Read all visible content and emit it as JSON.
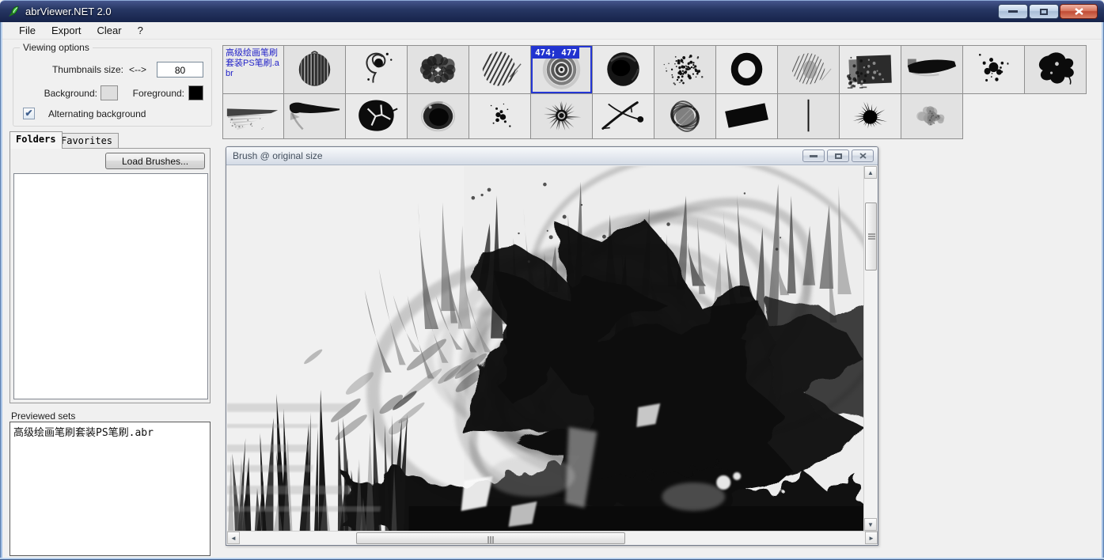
{
  "app": {
    "title": "abrViewer.NET 2.0"
  },
  "menu": {
    "items": [
      {
        "label": "File"
      },
      {
        "label": "Export"
      },
      {
        "label": "Clear"
      },
      {
        "label": "?"
      }
    ]
  },
  "viewing_options": {
    "group_label": "Viewing options",
    "thumbnails_size_label": "Thumbnails size:",
    "size_arrows": "<-->",
    "thumbnails_size_value": "80",
    "background_label": "Background:",
    "background_color": "#dedede",
    "foreground_label": "Foreground:",
    "foreground_color": "#000000",
    "alternating_label": "Alternating background",
    "alternating_checked": true
  },
  "tabs": [
    {
      "label": "Folders",
      "active": true
    },
    {
      "label": "Favorites",
      "active": false
    }
  ],
  "load_brushes_button": "Load Brushes...",
  "folder_list": {
    "items": []
  },
  "previewed_sets": {
    "label": "Previewed sets",
    "items": [
      "高级绘画笔刷套装PS笔刷.abr"
    ]
  },
  "brush_grid": {
    "set_name": "高级绘画笔刷套装PS笔刷.abr",
    "selected": {
      "row": 0,
      "index": 5,
      "size_label": "474; 477"
    },
    "row1": [
      "set-label",
      "streaked-sphere",
      "swirl-dots",
      "fuzzy-rosette",
      "hatch-ball",
      "concentric-rings",
      "glossy-ball",
      "speckle-blob",
      "thick-ring",
      "fingerprint-oval",
      "grunge-block",
      "dark-wedge",
      "splat-dots",
      "ink-splat"
    ],
    "row2": [
      "fade-smear",
      "taper-stroke",
      "cracked-rock",
      "dark-iris",
      "dot-cluster",
      "starburst",
      "twigs",
      "scribble-ball",
      "black-rect",
      "vertical-line",
      "spiky-tuft",
      "mottled-blob"
    ]
  },
  "preview_window": {
    "title": "Brush @ original size"
  },
  "icons": {
    "checkmark": "✔",
    "scroll_up": "▲",
    "scroll_down": "▼",
    "scroll_left": "◄",
    "scroll_right": "►"
  },
  "colors": {
    "selection_blue": "#2133cf",
    "titlebar_navy": "#1e2c55",
    "set_name_blue": "#2323c8"
  }
}
